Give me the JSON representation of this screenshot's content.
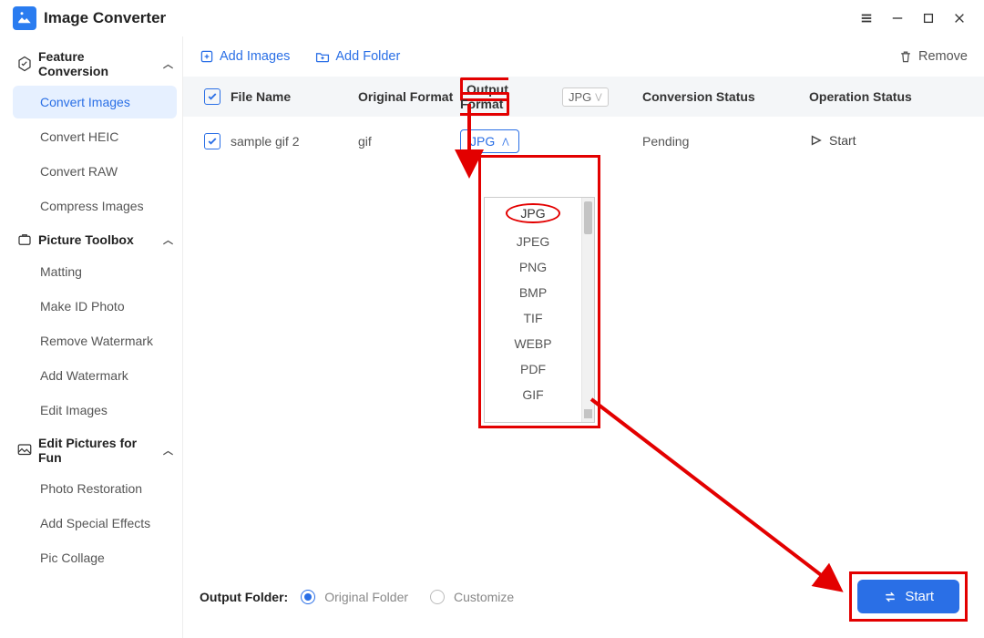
{
  "app": {
    "title": "Image Converter"
  },
  "window": {
    "hamburger": "menu-icon",
    "min": "minimize-icon",
    "max": "maximize-icon",
    "close": "close-icon"
  },
  "sidebar": {
    "sections": [
      {
        "title": "Feature Conversion",
        "items": [
          "Convert Images",
          "Convert HEIC",
          "Convert RAW",
          "Compress Images"
        ],
        "active_index": 0
      },
      {
        "title": "Picture Toolbox",
        "items": [
          "Matting",
          "Make ID Photo",
          "Remove Watermark",
          "Add Watermark",
          "Edit Images"
        ]
      },
      {
        "title": "Edit Pictures for Fun",
        "items": [
          "Photo Restoration",
          "Add Special Effects",
          "Pic Collage"
        ]
      }
    ]
  },
  "toolbar": {
    "add_images": "Add Images",
    "add_folder": "Add Folder",
    "remove": "Remove"
  },
  "columns": {
    "file_name": "File Name",
    "original_format": "Original Format",
    "output_format": "Output Format",
    "output_format_selected": "JPG",
    "conversion_status": "Conversion Status",
    "operation_status": "Operation Status"
  },
  "rows": [
    {
      "file_name": "sample gif 2",
      "original_format": "gif",
      "output_selected": "JPG",
      "status": "Pending",
      "op": "Start"
    }
  ],
  "dropdown": {
    "options": [
      "JPG",
      "JPEG",
      "PNG",
      "BMP",
      "TIF",
      "WEBP",
      "PDF",
      "GIF"
    ],
    "selected_index": 0
  },
  "footer": {
    "label": "Output Folder:",
    "option_original": "Original Folder",
    "option_customize": "Customize",
    "selected": "original",
    "start": "Start"
  }
}
